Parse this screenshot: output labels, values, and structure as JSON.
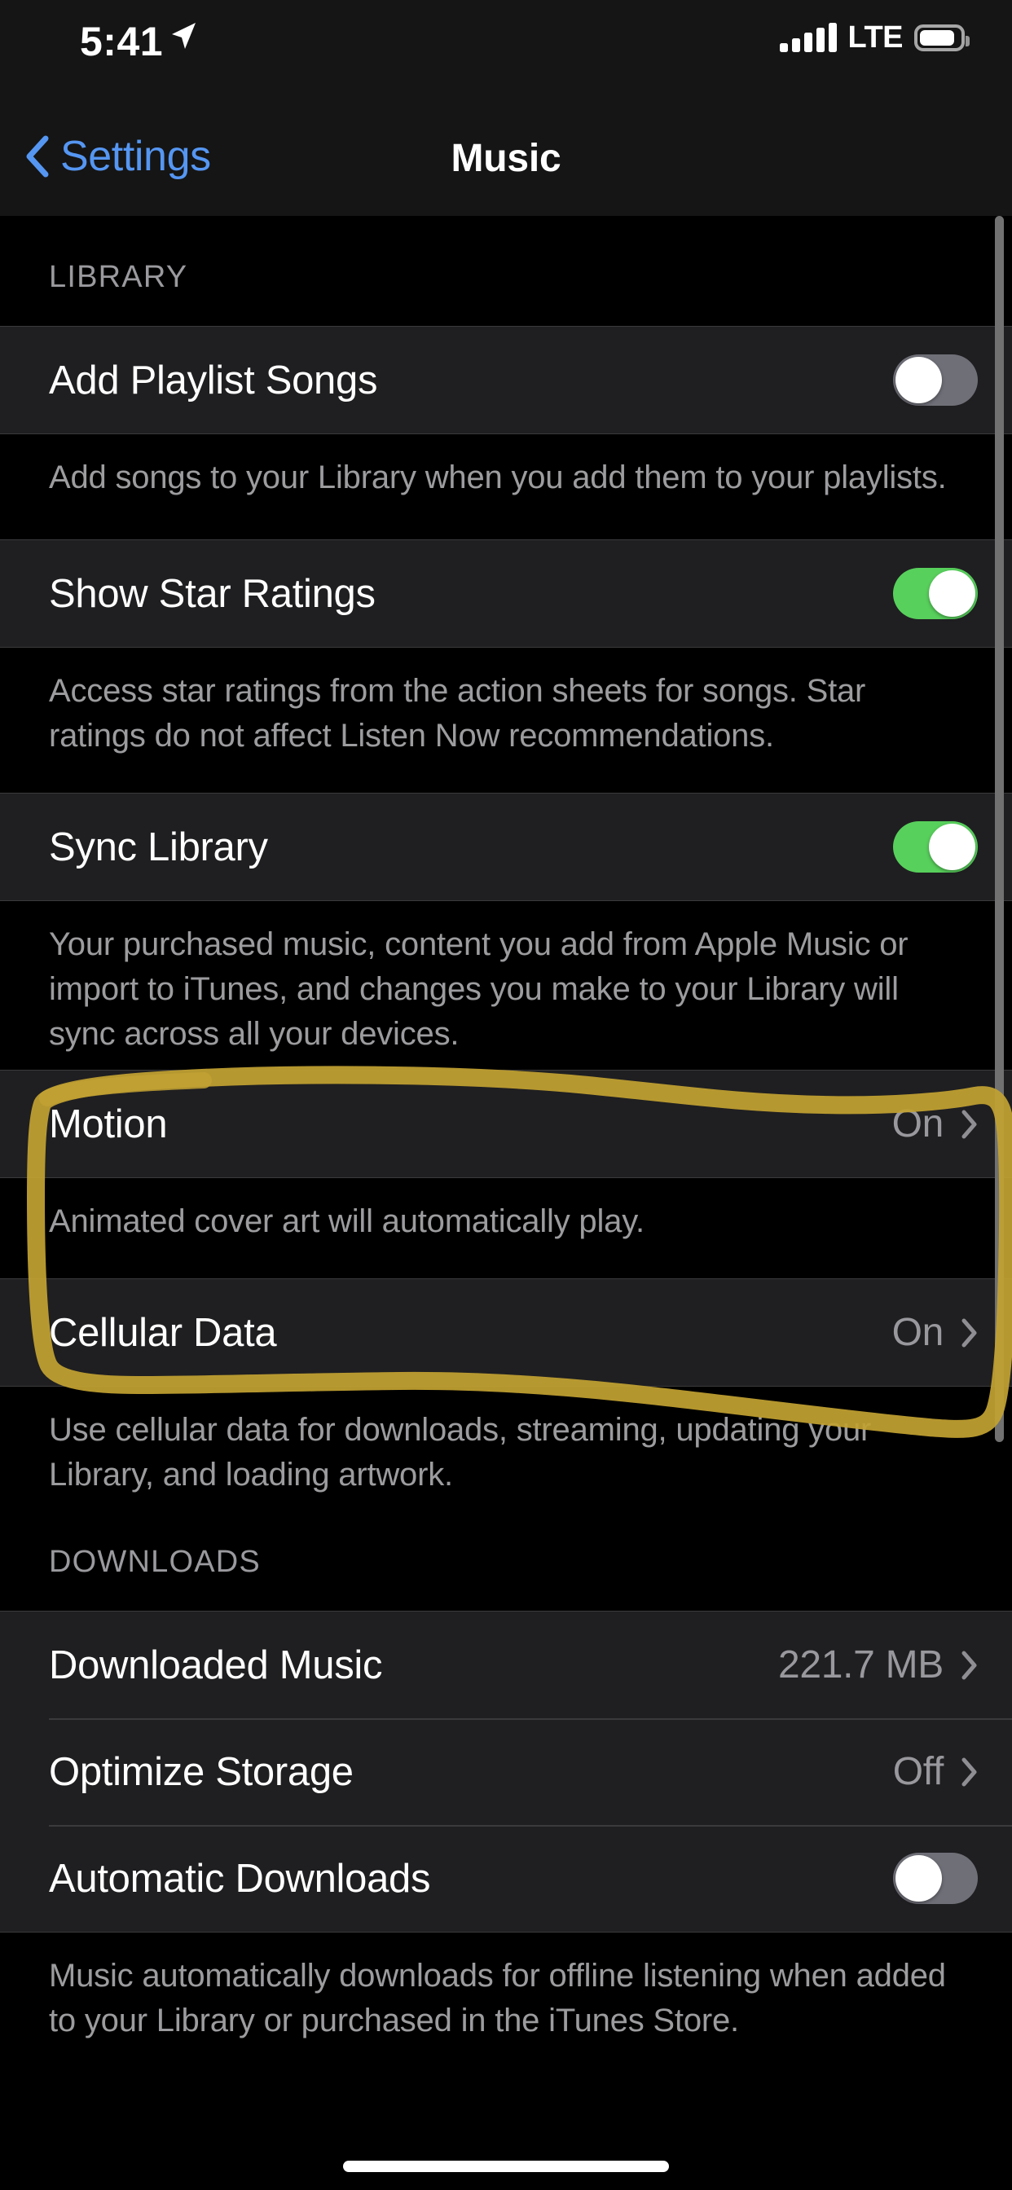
{
  "status_bar": {
    "time": "5:41",
    "location_icon": "location-arrow-icon",
    "carrier_tech": "LTE",
    "signal_bars": 5,
    "battery_percent": 78
  },
  "nav": {
    "back_label": "Settings",
    "title": "Music"
  },
  "sections": [
    {
      "header": "LIBRARY",
      "rows": [
        {
          "label": "Add Playlist Songs",
          "type": "toggle",
          "state": "off"
        }
      ],
      "footer": "Add songs to your Library when you add them to your playlists."
    },
    {
      "header": "",
      "rows": [
        {
          "label": "Show Star Ratings",
          "type": "toggle",
          "state": "on"
        }
      ],
      "footer": "Access star ratings from the action sheets for songs. Star ratings do not affect Listen Now recommendations."
    },
    {
      "header": "",
      "rows": [
        {
          "label": "Sync Library",
          "type": "toggle",
          "state": "on"
        }
      ],
      "footer": "Your purchased music, content you add from Apple Music or import to iTunes, and changes you make to your Library will sync across all your devices."
    },
    {
      "header": "",
      "rows": [
        {
          "label": "Motion",
          "type": "disclosure",
          "value": "On"
        }
      ],
      "footer": "Animated cover art will automatically play."
    },
    {
      "header": "",
      "rows": [
        {
          "label": "Cellular Data",
          "type": "disclosure",
          "value": "On"
        }
      ],
      "footer": "Use cellular data for downloads, streaming, updating your Library, and loading artwork."
    },
    {
      "header": "DOWNLOADS",
      "rows": [
        {
          "label": "Downloaded Music",
          "type": "disclosure",
          "value": "221.7 MB"
        },
        {
          "label": "Optimize Storage",
          "type": "disclosure",
          "value": "Off"
        },
        {
          "label": "Automatic Downloads",
          "type": "toggle",
          "state": "off"
        }
      ],
      "footer": "Music automatically downloads for offline listening when added to your Library or purchased in the iTunes Store."
    }
  ],
  "annotation": {
    "shape": "hand-drawn-rounded-rectangle",
    "color": "#c2a132",
    "target_row_label": "Motion"
  },
  "colors": {
    "accent_blue": "#5596f2",
    "toggle_on_green": "#58d05c",
    "toggle_off_gray": "#6f6f78",
    "row_background": "#1f1f21",
    "page_background": "#000000",
    "secondary_text": "#98989d",
    "annotation_yellow": "#c2a132"
  }
}
